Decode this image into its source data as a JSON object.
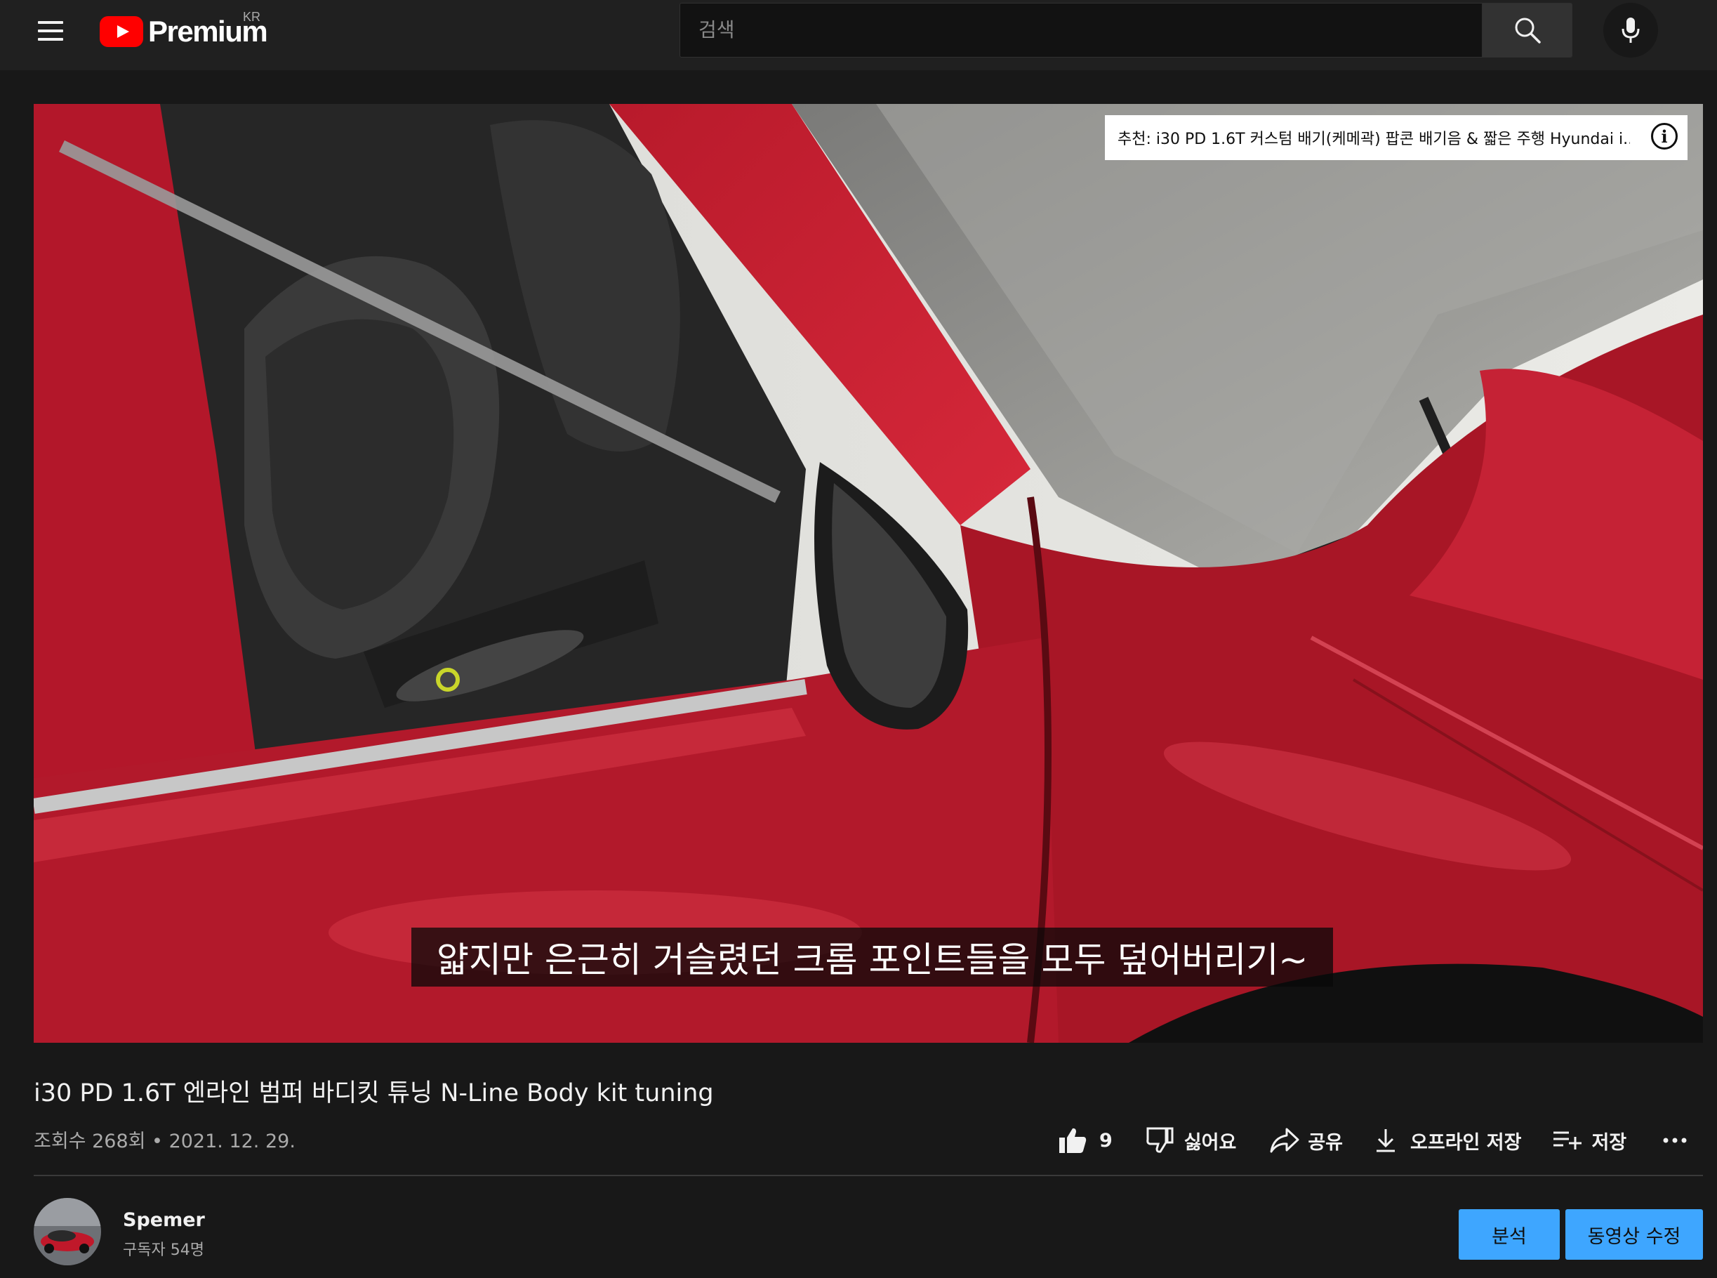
{
  "header": {
    "brand": "Premium",
    "region": "KR",
    "search_placeholder": "검색"
  },
  "player": {
    "card_text": "추천: i30 PD 1.6T 커스텀 배기(케메곽) 팝콘 배기음 & 짧은 주행 Hyundai i...",
    "card_info_icon": "i",
    "caption": "얇지만 은근히 거슬렸던 크롬 포인트들을 모두 덮어버리기~"
  },
  "video": {
    "title": "i30 PD 1.6T 엔라인 범퍼 바디킷 튜닝 N-Line Body kit tuning",
    "meta": "조회수 268회 • 2021. 12. 29."
  },
  "actions": {
    "like_count": "9",
    "dislike_label": "싫어요",
    "share_label": "공유",
    "download_label": "오프라인 저장",
    "save_label": "저장"
  },
  "channel": {
    "name": "Spemer",
    "subscribers": "구독자 54명",
    "analytics_label": "분석",
    "edit_label": "동영상 수정"
  },
  "colors": {
    "background": "#181818",
    "header": "#202020",
    "accent_blue": "#3ea6ff",
    "logo_red": "#ff0000"
  }
}
